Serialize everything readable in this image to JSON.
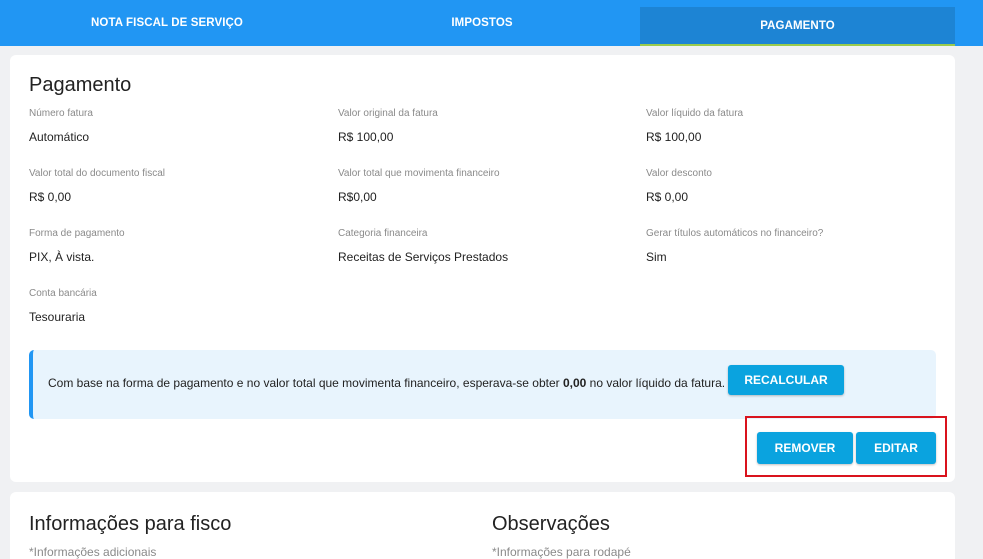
{
  "tabs": [
    {
      "label": "NOTA FISCAL DE SERVIÇO"
    },
    {
      "label": "IMPOSTOS"
    },
    {
      "label": "PAGAMENTO"
    }
  ],
  "pagamento": {
    "title": "Pagamento",
    "fields": {
      "numero_fatura": {
        "label": "Número fatura",
        "value": "Automático"
      },
      "valor_original": {
        "label": "Valor original da fatura",
        "value": "R$ 100,00"
      },
      "valor_liquido": {
        "label": "Valor líquido da fatura",
        "value": "R$ 100,00"
      },
      "valor_total_doc": {
        "label": "Valor total do documento fiscal",
        "value": "R$ 0,00"
      },
      "valor_total_mov": {
        "label": "Valor total que movimenta financeiro",
        "value": "R$0,00"
      },
      "valor_desconto": {
        "label": "Valor desconto",
        "value": "R$ 0,00"
      },
      "forma_pagamento": {
        "label": "Forma de pagamento",
        "value": "PIX, À vista."
      },
      "categoria": {
        "label": "Categoria financeira",
        "value": "Receitas de Serviços Prestados"
      },
      "gerar_titulos": {
        "label": "Gerar títulos automáticos no financeiro?",
        "value": "Sim"
      },
      "conta_bancaria": {
        "label": "Conta bancária",
        "value": "Tesouraria"
      }
    },
    "info": {
      "text_before": "Com base na forma de pagamento e no valor total que movimenta financeiro, esperava-se obter ",
      "amount": "0,00",
      "text_after": " no valor líquido da fatura."
    },
    "buttons": {
      "recalcular": "RECALCULAR",
      "remover": "REMOVER",
      "editar": "EDITAR"
    }
  },
  "fisco": {
    "title": "Informações para fisco",
    "subtitle": "*Informações adicionais"
  },
  "observacoes": {
    "title": "Observações",
    "subtitle": "*Informações para rodapé"
  },
  "colors": {
    "header": "#2196f3",
    "button": "#0aa3df",
    "highlight": "#d9131d",
    "info_bg": "#e8f4fd"
  }
}
